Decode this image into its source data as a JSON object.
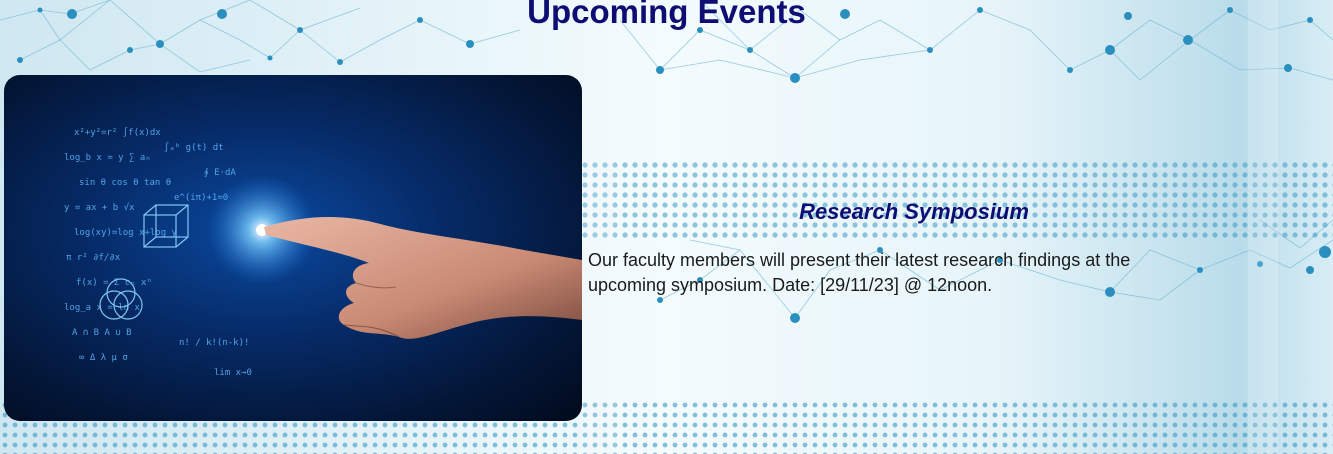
{
  "section": {
    "title": "Upcoming Events"
  },
  "events": [
    {
      "title": "Research Symposium",
      "description": "Our faculty members will present their latest research findings at the upcoming symposium. Date: [29/11/23] @ 12noon.",
      "image": "hand-touching-math-hologram"
    }
  ],
  "colors": {
    "heading": "#0d0d73",
    "accent_dots": "#2a8fbf",
    "image_bg": "#062a66"
  }
}
